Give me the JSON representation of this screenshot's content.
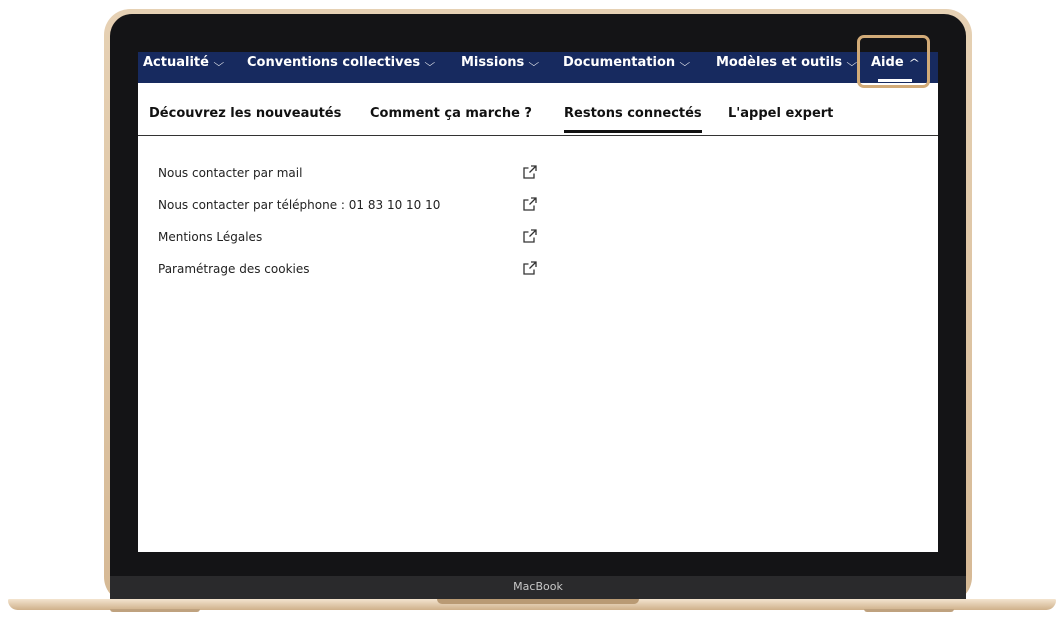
{
  "device": {
    "label": "MacBook"
  },
  "topnav": {
    "items": [
      {
        "label": "Actualité"
      },
      {
        "label": "Conventions collectives"
      },
      {
        "label": "Missions"
      },
      {
        "label": "Documentation"
      },
      {
        "label": "Modèles et outils"
      },
      {
        "label": "Aide"
      }
    ],
    "chevron_down": "⌵",
    "chevron_up": "^"
  },
  "subtabs": [
    {
      "label": "Découvrez les nouveautés"
    },
    {
      "label": "Comment ça marche ?"
    },
    {
      "label": "Restons connectés"
    },
    {
      "label": "L'appel expert"
    }
  ],
  "links": [
    {
      "label": "Nous contacter par mail",
      "icon": "external-link-icon"
    },
    {
      "label": "Nous contacter par téléphone : 01 83 10 10 10",
      "icon": "external-link-icon"
    },
    {
      "label": "Mentions Légales",
      "icon": "external-link-icon"
    },
    {
      "label": "Paramétrage des cookies",
      "icon": "external-link-icon"
    }
  ],
  "colors": {
    "nav_background": "#172a5f",
    "highlight_border": "#d2ab78",
    "laptop_gold": "#d6b995"
  }
}
